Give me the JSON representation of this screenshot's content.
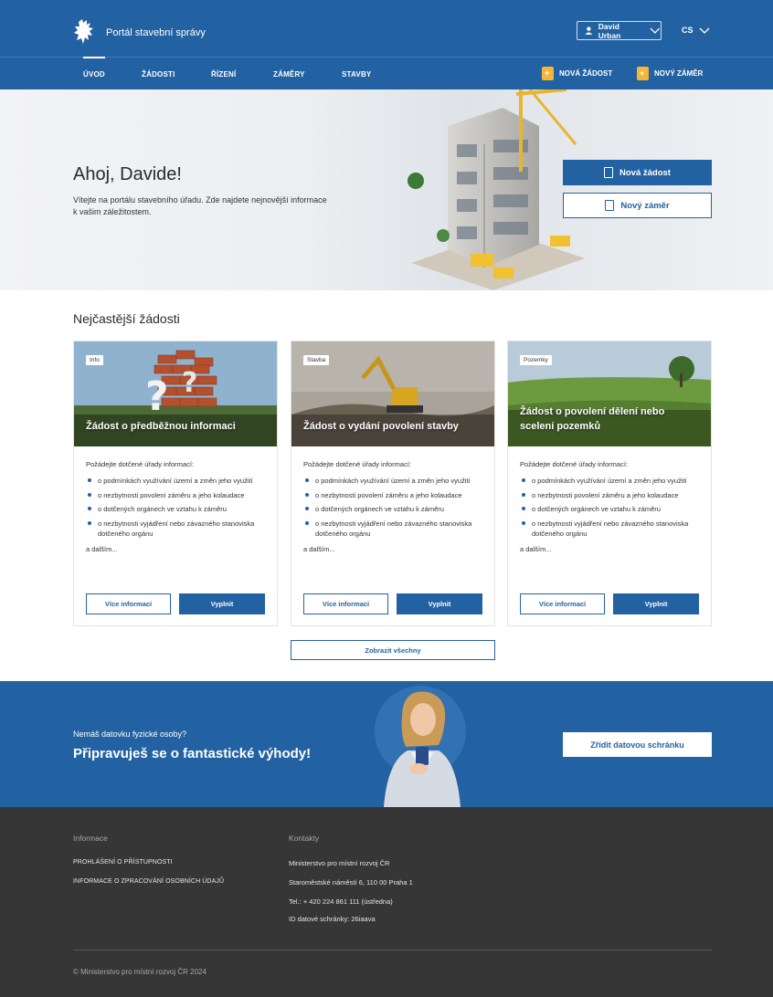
{
  "header": {
    "portal_name": "Portál stavební správy",
    "user_name": "David Urban",
    "language": "CS"
  },
  "nav": {
    "items": [
      {
        "label": "ÚVOD",
        "active": true
      },
      {
        "label": "ŽÁDOSTI"
      },
      {
        "label": "ŘÍZENÍ"
      },
      {
        "label": "ZÁMĚRY"
      },
      {
        "label": "STAVBY"
      }
    ],
    "new_request": "NOVÁ ŽÁDOST",
    "new_plan": "NOVÝ ZÁMĚR"
  },
  "hero": {
    "title": "Ahoj, Davide!",
    "text": "Vítejte na portálu stavebního úřadu. Zde najdete nejnovější informace k vašim záležitostem.",
    "btn_primary": "Nová žádost",
    "btn_secondary": "Nový záměr"
  },
  "requests": {
    "section_title": "Nejčastější žádosti",
    "cards": [
      {
        "tag": "Info",
        "title": "Žádost o předběžnou informaci",
        "intro": "Požádejte dotčené úřady informací:",
        "items": [
          "o podmínkách využívání území a změn jeho využití",
          "o nezbytnosti povolení záměru a jeho kolaudace",
          "o dotčených orgánech ve vztahu k záměru",
          "o nezbytnosti vyjádření nebo závazného stanoviska dotčeného orgánu"
        ],
        "more": "a dalším...",
        "btn_more": "Více informací",
        "btn_fill": "Vyplnit"
      },
      {
        "tag": "Stavba",
        "title": "Žádost o vydání povolení stavby",
        "intro": "Požádejte dotčené úřady informací:",
        "items": [
          "o podmínkách využívání území a změn jeho využití",
          "o nezbytnosti povolení záměru a jeho kolaudace",
          "o dotčených orgánech ve vztahu k záměru",
          "o nezbytnosti vyjádření nebo závazného stanoviska dotčeného orgánu"
        ],
        "more": "a dalším...",
        "btn_more": "Více informací",
        "btn_fill": "Vyplnit"
      },
      {
        "tag": "Pozemky",
        "title": "Žádost o povolení dělení nebo scelení pozemků",
        "intro": "Požádejte dotčené úřady informací:",
        "items": [
          "o podmínkách využívání území a změn jeho využití",
          "o nezbytnosti povolení záměru a jeho kolaudace",
          "o dotčených orgánech ve vztahu k záměru",
          "o nezbytnosti vyjádření nebo závazného stanoviska dotčeného orgánu"
        ],
        "more": "a dalším...",
        "btn_more": "Více informací",
        "btn_fill": "Vyplnit"
      }
    ],
    "show_all": "Zobrazit všechny"
  },
  "promo": {
    "small": "Nemáš datovku fyzické osoby?",
    "big": "Připravuješ se o fantastické výhody!",
    "btn": "Zřídit datovou schránku"
  },
  "footer": {
    "info_head": "Informace",
    "info_links": [
      "PROHLÁŠENÍ O PŘÍSTUPNOSTI",
      "INFORMACE O ZPRACOVÁNÍ OSOBNÍCH ÚDAJŮ"
    ],
    "contacts_head": "Kontakty",
    "contacts": [
      "Ministerstvo pro místní rozvoj ČR",
      "Staroměstské náměstí 6, 110 00 Praha 1",
      "Tel.: + 420 224 861 111 (ústředna)",
      "ID datové schránky: 26iaava"
    ],
    "copyright": "© Ministerstvo pro místní rozvoj ČR 2024"
  },
  "colors": {
    "primary": "#2362a2",
    "footer_bg": "#363636",
    "accent_icon": "#f3b53a"
  }
}
